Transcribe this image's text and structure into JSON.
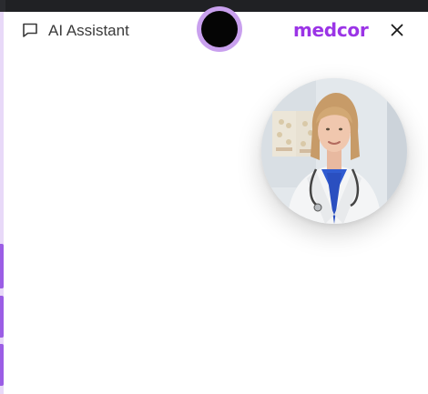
{
  "header": {
    "title": "AI Assistant",
    "logo_text": "medcor",
    "chat_icon": "chat-bubble-icon",
    "close_icon": "close-icon"
  },
  "avatar": {
    "alt": "Doctor avatar",
    "icon": "doctor-avatar-image"
  },
  "colors": {
    "brand": "#9b34e6",
    "accent_ring": "#c9a0ee",
    "rail_mark": "#9b5de5",
    "top_strip": "#202124"
  }
}
